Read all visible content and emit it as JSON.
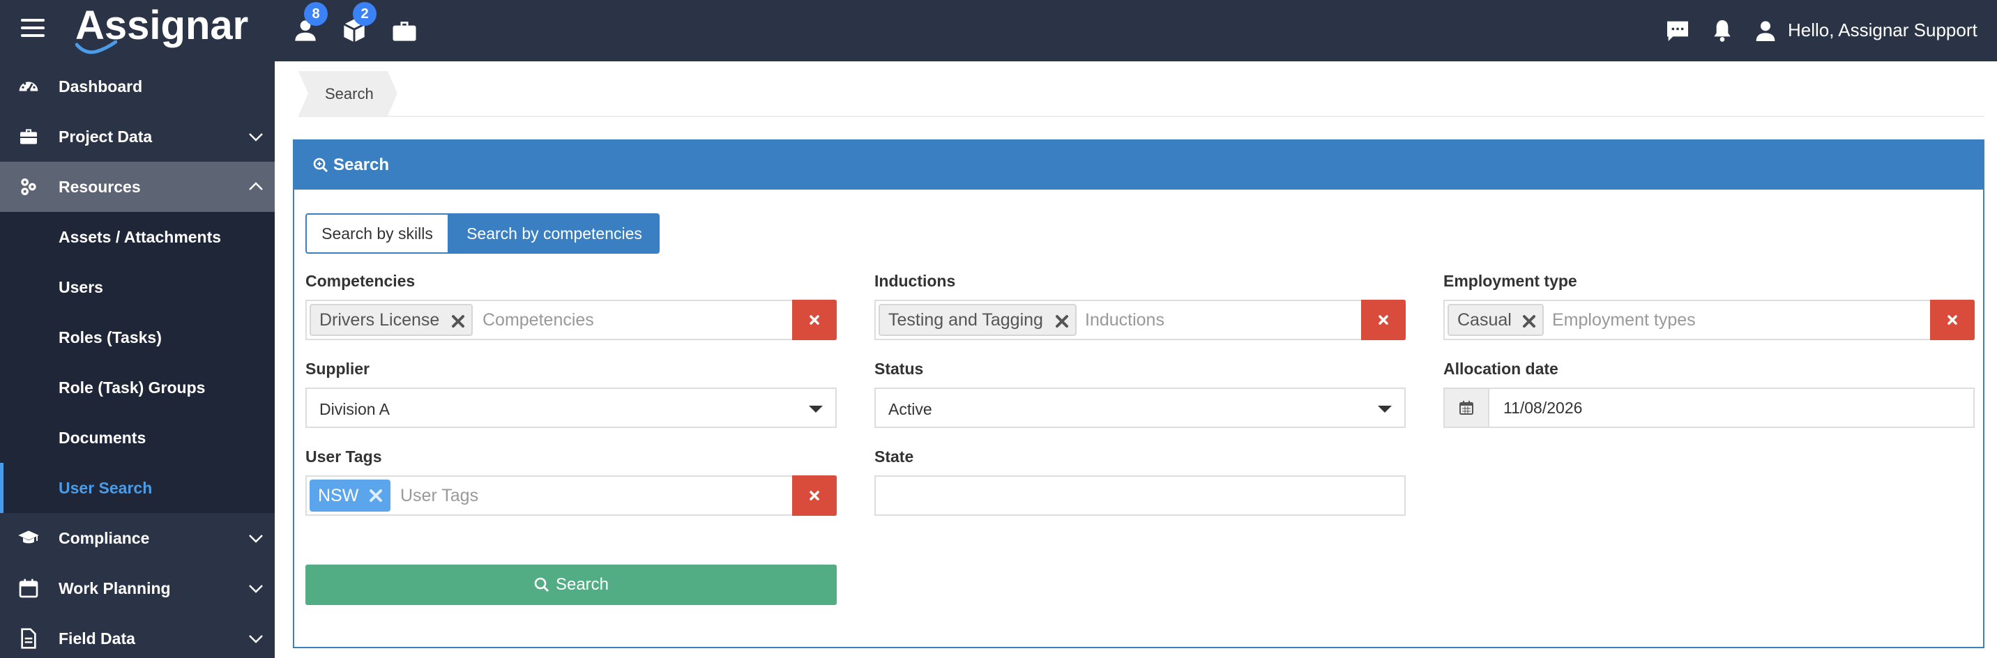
{
  "header": {
    "brand": "Assignar",
    "badges": {
      "users": "8",
      "boxes": "2"
    },
    "greeting": "Hello, Assignar Support",
    "icons": [
      "menu-icon",
      "users-icon",
      "box-icon",
      "briefcase-icon",
      "chat-icon",
      "bell-icon",
      "user-icon"
    ]
  },
  "sidebar": {
    "items": [
      {
        "label": "Dashboard",
        "icon": "dashboard-icon"
      },
      {
        "label": "Project Data",
        "icon": "briefcase-icon"
      },
      {
        "label": "Resources",
        "icon": "resources-icon"
      },
      {
        "label": "Compliance",
        "icon": "graduation-cap-icon"
      },
      {
        "label": "Work Planning",
        "icon": "calendar-icon"
      },
      {
        "label": "Field Data",
        "icon": "document-icon"
      }
    ],
    "sub_items": [
      {
        "label": "Assets / Attachments"
      },
      {
        "label": "Users"
      },
      {
        "label": "Roles (Tasks)"
      },
      {
        "label": "Role (Task) Groups"
      },
      {
        "label": "Documents"
      },
      {
        "label": "User Search"
      }
    ]
  },
  "breadcrumb": {
    "current": "Search"
  },
  "panel": {
    "title": "Search",
    "tabs": {
      "skills": "Search by skills",
      "competencies": "Search by competencies"
    },
    "competencies": {
      "label": "Competencies",
      "tag": "Drivers License",
      "placeholder": "Competencies"
    },
    "inductions": {
      "label": "Inductions",
      "tag": "Testing and Tagging",
      "placeholder": "Inductions"
    },
    "employment": {
      "label": "Employment type",
      "tag": "Casual",
      "placeholder": "Employment types"
    },
    "supplier": {
      "label": "Supplier",
      "value": "Division A"
    },
    "status": {
      "label": "Status",
      "value": "Active"
    },
    "allocation": {
      "label": "Allocation date",
      "value": "11/08/2026"
    },
    "user_tags": {
      "label": "User Tags",
      "tag": "NSW",
      "placeholder": "User Tags"
    },
    "state": {
      "label": "State",
      "value": ""
    },
    "search_button": "Search"
  },
  "colors": {
    "topbar": "#2b3447",
    "accent": "#3a7fc1",
    "danger": "#d94b3b",
    "success": "#52ac84",
    "active_link": "#4b9ce8"
  }
}
